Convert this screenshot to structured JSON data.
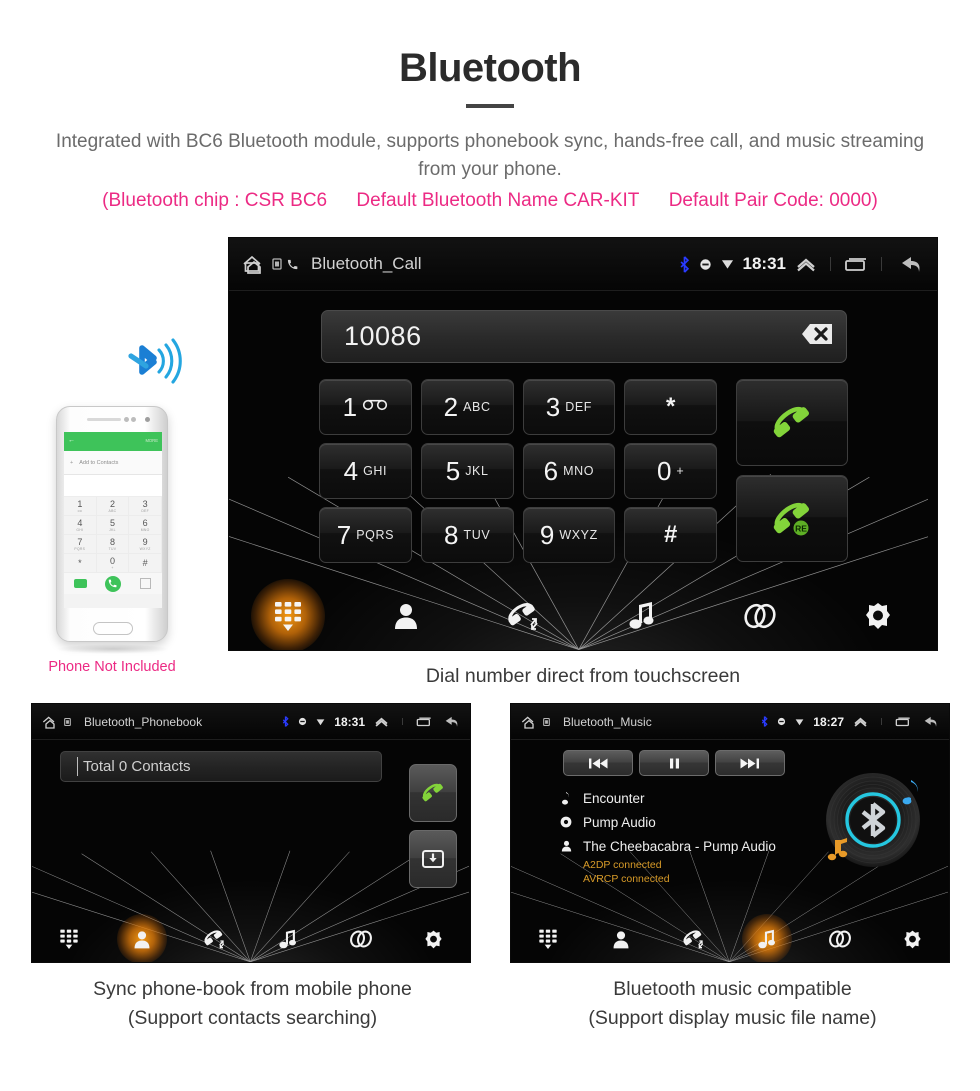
{
  "header": {
    "title": "Bluetooth",
    "subtitle": "Integrated with BC6 Bluetooth module, supports phonebook sync, hands-free call, and music streaming from your phone.",
    "spec_chip": "(Bluetooth chip : CSR BC6",
    "spec_name": "Default Bluetooth Name CAR-KIT",
    "spec_pair": "Default Pair Code: 0000)",
    "accent_pink": "#ec2a84",
    "text_gray": "#6b6b6b"
  },
  "dialer": {
    "statusbar": {
      "title": "Bluetooth_Call",
      "clock": "18:31",
      "icons": [
        "home-icon",
        "sdcard-icon",
        "phone-icon",
        "bluetooth-icon",
        "usb-icon",
        "wifi-icon",
        "expand-icon",
        "recents-icon",
        "back-icon"
      ]
    },
    "number_value": "10086",
    "backspace_label": "backspace-icon",
    "keys": [
      {
        "digit": "1",
        "sub": "",
        "voicemail": true
      },
      {
        "digit": "2",
        "sub": "ABC"
      },
      {
        "digit": "3",
        "sub": "DEF"
      },
      {
        "digit": "*",
        "sub": "",
        "symbol": true
      },
      {
        "digit": "4",
        "sub": "GHI"
      },
      {
        "digit": "5",
        "sub": "JKL"
      },
      {
        "digit": "6",
        "sub": "MNO"
      },
      {
        "digit": "0",
        "sub": "+"
      },
      {
        "digit": "7",
        "sub": "PQRS"
      },
      {
        "digit": "8",
        "sub": "TUV"
      },
      {
        "digit": "9",
        "sub": "WXYZ"
      },
      {
        "digit": "#",
        "sub": "",
        "symbol": true
      }
    ],
    "call_button": "call-button",
    "redial_button": "redial-button",
    "redial_badge": "RE",
    "nav": [
      {
        "name": "dialpad",
        "active": true
      },
      {
        "name": "contacts",
        "active": false
      },
      {
        "name": "call-log",
        "active": false
      },
      {
        "name": "music",
        "active": false
      },
      {
        "name": "link",
        "active": false
      },
      {
        "name": "settings",
        "active": false
      }
    ],
    "caption": "Dial number direct from touchscreen"
  },
  "phone_mockup": {
    "add_to_contacts": "Add to Contacts",
    "more_label": "MORE",
    "keys": [
      {
        "d": "1",
        "s": "oo"
      },
      {
        "d": "2",
        "s": "ABC"
      },
      {
        "d": "3",
        "s": "DEF"
      },
      {
        "d": "4",
        "s": "GHI"
      },
      {
        "d": "5",
        "s": "JKL"
      },
      {
        "d": "6",
        "s": "MNO"
      },
      {
        "d": "7",
        "s": "PQRS"
      },
      {
        "d": "8",
        "s": "TUV"
      },
      {
        "d": "9",
        "s": "WXYZ"
      },
      {
        "d": "*",
        "s": ""
      },
      {
        "d": "0",
        "s": "+"
      },
      {
        "d": "#",
        "s": ""
      }
    ],
    "not_included": "Phone Not Included",
    "bluetooth_logo_color": "#1b9ad6"
  },
  "phonebook": {
    "statusbar": {
      "title": "Bluetooth_Phonebook",
      "clock": "18:31"
    },
    "search_value": "Total 0 Contacts",
    "side_buttons": [
      "call-button",
      "download-contacts-button"
    ],
    "nav": [
      {
        "name": "dialpad",
        "active": false
      },
      {
        "name": "contacts",
        "active": true
      },
      {
        "name": "call-log",
        "active": false
      },
      {
        "name": "music",
        "active": false
      },
      {
        "name": "link",
        "active": false
      },
      {
        "name": "settings",
        "active": false
      }
    ],
    "caption_line1": "Sync phone-book from mobile phone",
    "caption_line2": "(Support contacts searching)"
  },
  "music": {
    "statusbar": {
      "title": "Bluetooth_Music",
      "clock": "18:27"
    },
    "transport": [
      "prev-track-button",
      "pause-button",
      "next-track-button"
    ],
    "track": "Encounter",
    "album": "Pump Audio",
    "artist": "The Cheebacabra - Pump Audio",
    "status_a2dp": "A2DP connected",
    "status_avrcp": "AVRCP connected",
    "status_color": "#d89b28",
    "disc_accent": "#25c7e0",
    "nav": [
      {
        "name": "dialpad",
        "active": false
      },
      {
        "name": "contacts",
        "active": false
      },
      {
        "name": "call-log",
        "active": false
      },
      {
        "name": "music",
        "active": true
      },
      {
        "name": "link",
        "active": false
      },
      {
        "name": "settings",
        "active": false
      }
    ],
    "caption_line1": "Bluetooth music compatible",
    "caption_line2": "(Support display music file name)"
  }
}
